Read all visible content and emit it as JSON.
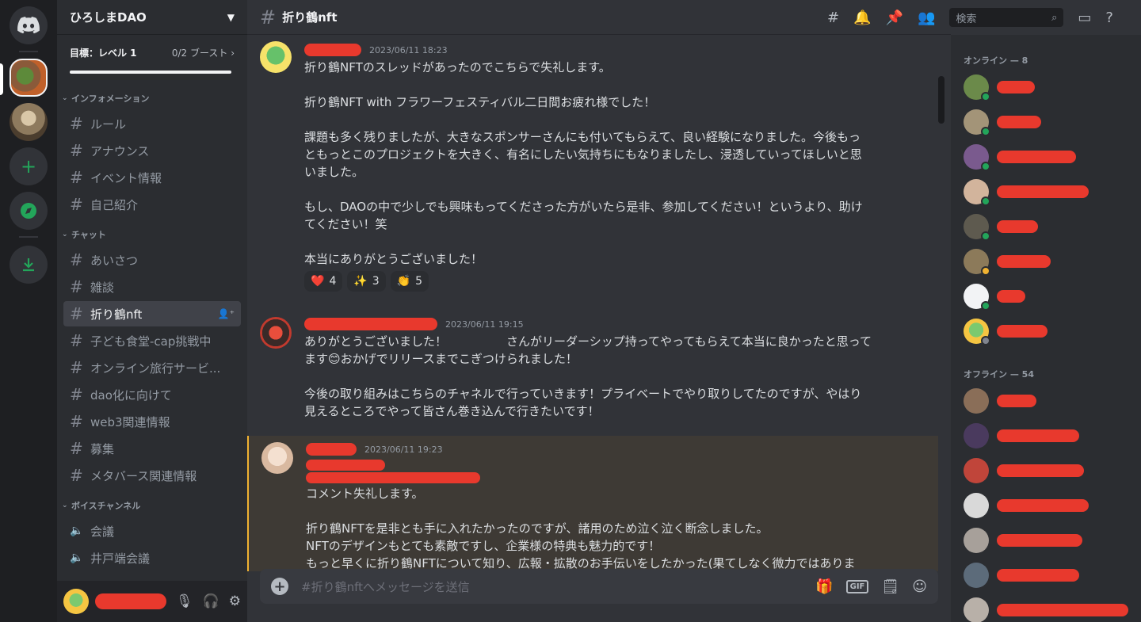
{
  "server": {
    "name": "ひろしまDAO",
    "boost_goal": "目標：レベル 1",
    "boost_count": "0/2 ブースト"
  },
  "categories": [
    {
      "label": "インフォメーション",
      "channels": [
        "ルール",
        "アナウンス",
        "イベント情報",
        "自己紹介"
      ]
    },
    {
      "label": "チャット",
      "channels": [
        "あいさつ",
        "雑談",
        "折り鶴nft",
        "子ども食堂-cap挑戦中",
        "オンライン旅行サービ...",
        "dao化に向けて",
        "web3関連情報",
        "募集",
        "メタバース関連情報"
      ]
    },
    {
      "label": "ボイスチャンネル",
      "channels": [
        "会議",
        "井戸端会議"
      ]
    }
  ],
  "active_channel": "折り鶴nft",
  "toolbar": {
    "search_placeholder": "検索"
  },
  "messages": [
    {
      "time": "2023/06/11 18:23",
      "text": "折り鶴NFTのスレッドがあったのでこちらで失礼します。\n\n折り鶴NFT with フラワーフェスティバル二日間お疲れ様でした！\n\n課題も多く残りましたが、大きなスポンサーさんにも付いてもらえて、良い経験になりました。今後もっ\nともっとこのプロジェクトを大きく、有名にしたい気持ちにもなりましたし、浸透していってほしいと思\nいました。\n\nもし、DAOの中で少しでも興味もってくださった方がいたら是非、参加してください！というより、助け\nてください！笑\n\n本当にありがとうございました！",
      "reactions": [
        {
          "emoji": "❤️",
          "count": "4"
        },
        {
          "emoji": "✨",
          "count": "3"
        },
        {
          "emoji": "👏",
          "count": "5"
        }
      ]
    },
    {
      "time": "2023/06/11 19:15",
      "text": "ありがとうございました！　　　　　さんがリーダーシップ持ってやってもらえて本当に良かったと思って\nます😊おかげでリリースまでこぎつけられました！\n\n今後の取り組みはこちらのチャネルで行っていきます！プライベートでやり取りしてたのですが、やはり\n見えるところでやって皆さん巻き込んで行きたいです！"
    },
    {
      "time": "2023/06/11 19:23",
      "text": "コメント失礼します。\n\n折り鶴NFTを是非とも手に入れたかったのですが、諸用のため泣く泣く断念しました。\nNFTのデザインもとても素敵ですし、企業様の特典も魅力的です！\nもっと早くに折り鶴NFTについて知り、広報・拡散のお手伝いをしたかった(果てしなく微力ではありま"
    }
  ],
  "composer": {
    "placeholder": "#折り鶴nftへメッセージを送信"
  },
  "members": {
    "online_label": "オンライン — 8",
    "offline_label": "オフライン — 54"
  }
}
